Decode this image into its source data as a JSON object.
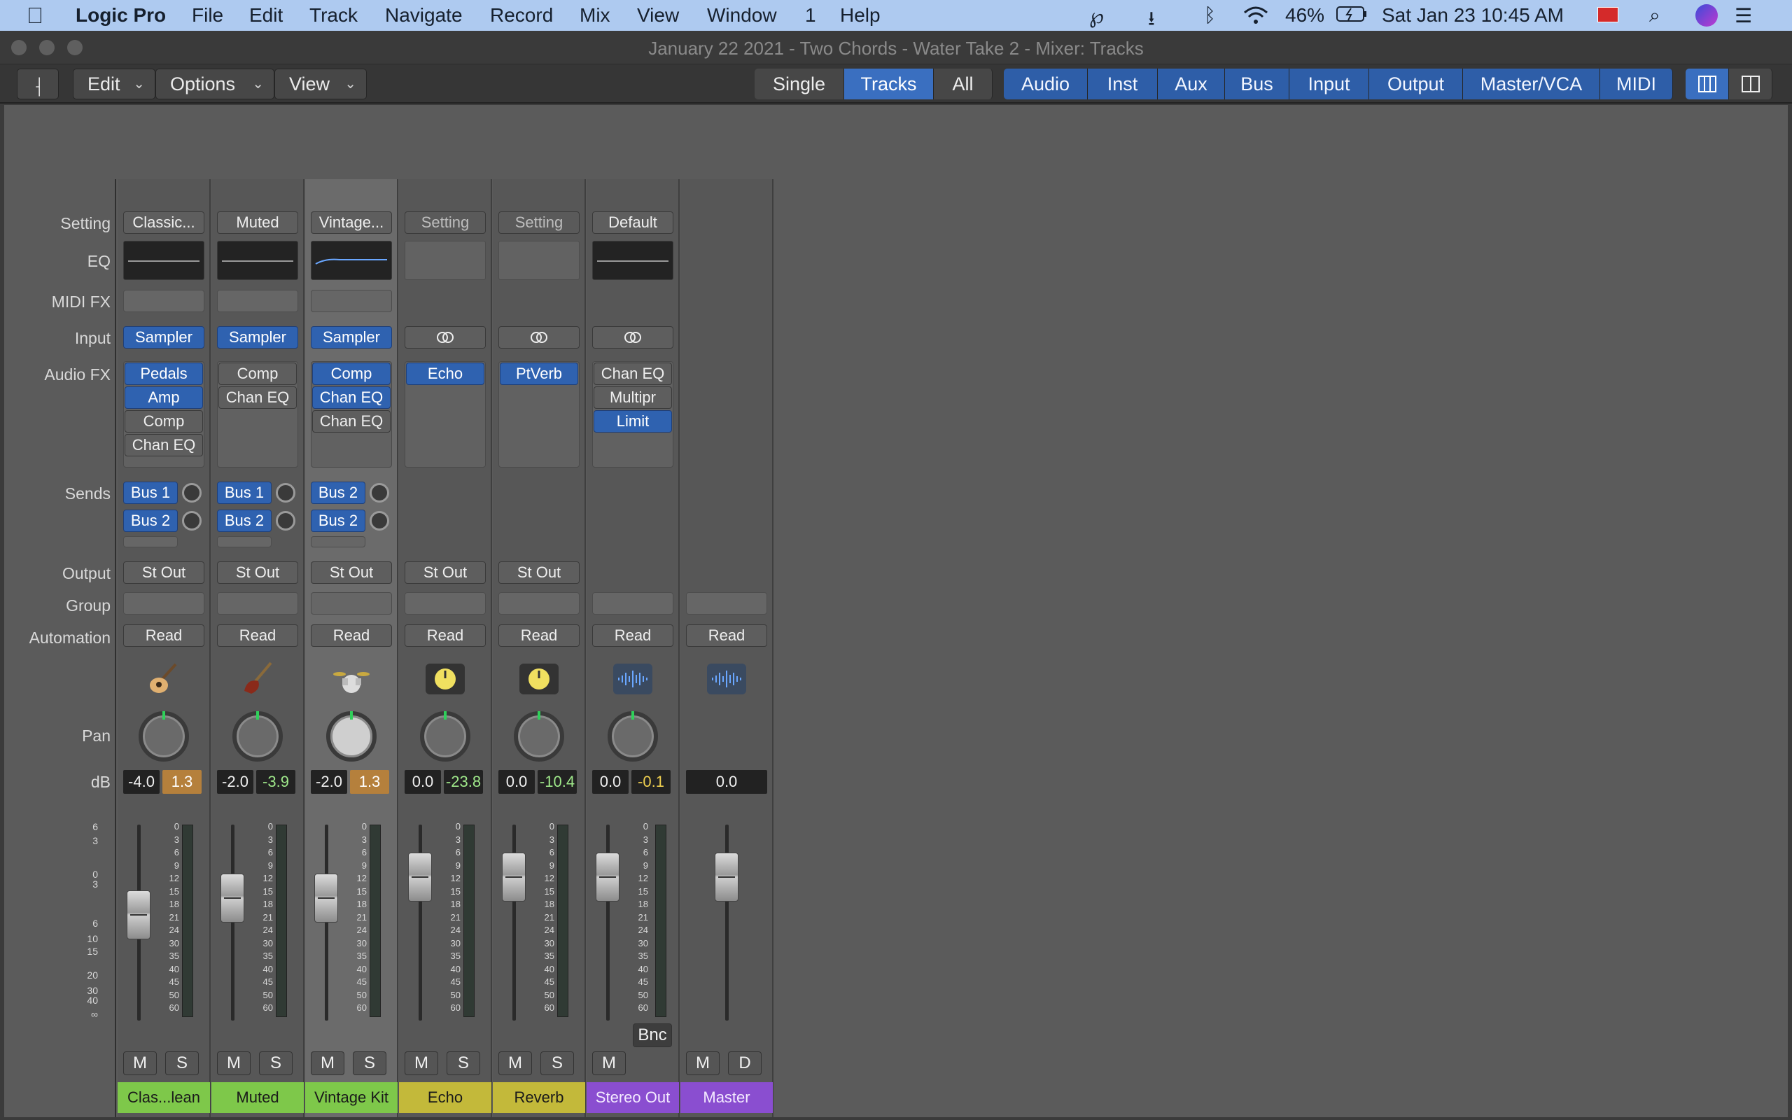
{
  "menubar": {
    "app": "Logic Pro",
    "items": [
      "File",
      "Edit",
      "Track",
      "Navigate",
      "Record",
      "Mix",
      "View",
      "Window",
      "1",
      "Help"
    ],
    "battery": "46%",
    "datetime": "Sat Jan 23  10:45 AM"
  },
  "window": {
    "title": "January 22 2021 - Two Chords - Water Take 2  - Mixer: Tracks"
  },
  "toolbar": {
    "menus": [
      "Edit",
      "Options",
      "View"
    ],
    "view_modes": [
      "Single",
      "Tracks",
      "All"
    ],
    "active_view_mode": "Tracks",
    "filters": [
      "Audio",
      "Inst",
      "Aux",
      "Bus",
      "Input",
      "Output",
      "Master/VCA",
      "MIDI"
    ]
  },
  "row_labels": {
    "setting": "Setting",
    "eq": "EQ",
    "midifx": "MIDI FX",
    "input": "Input",
    "audiofx": "Audio FX",
    "sends": "Sends",
    "output": "Output",
    "group": "Group",
    "automation": "Automation",
    "pan": "Pan",
    "db": "dB"
  },
  "fader_scale_left": [
    "6",
    "3",
    "0",
    "3",
    "6",
    "10",
    "15",
    "20",
    "30",
    "40",
    "∞"
  ],
  "meter_scale": [
    "0",
    "3",
    "6",
    "9",
    "12",
    "15",
    "18",
    "21",
    "24",
    "30",
    "35",
    "40",
    "45",
    "50",
    "60"
  ],
  "strips": [
    {
      "name": "Clas...lean",
      "setting": "Classic...",
      "eq_active": true,
      "input": "Sampler",
      "fx": [
        "Pedals",
        "Amp",
        "Comp",
        "Chan EQ"
      ],
      "fx_active": [
        true,
        true,
        false,
        false
      ],
      "sends": [
        "Bus 1",
        "Bus 2"
      ],
      "output": "St Out",
      "automation": "Read",
      "icon": "acoustic-guitar-icon",
      "db_left": "-4.0",
      "db_right": "1.3",
      "db_right_style": "orange",
      "mute": "M",
      "solo": "S",
      "color": "#7ec84a",
      "fader_db": -4.0
    },
    {
      "name": "Muted",
      "setting": "Muted",
      "eq_active": true,
      "input": "Sampler",
      "fx": [
        "Comp",
        "Chan EQ"
      ],
      "fx_active": [
        false,
        false
      ],
      "sends": [
        "Bus 1",
        "Bus 2"
      ],
      "output": "St Out",
      "automation": "Read",
      "icon": "electric-bass-icon",
      "db_left": "-2.0",
      "db_right": "-3.9",
      "db_right_style": "green",
      "mute": "M",
      "solo": "S",
      "color": "#7ec84a",
      "fader_db": -2.0
    },
    {
      "name": "Vintage Kit",
      "setting": "Vintage...",
      "eq_active": true,
      "input": "Sampler",
      "fx": [
        "Comp",
        "Chan EQ",
        "Chan EQ"
      ],
      "fx_active": [
        true,
        true,
        false
      ],
      "sends": [
        "Bus 2",
        "Bus 2"
      ],
      "output": "St Out",
      "automation": "Read",
      "icon": "drum-kit-icon",
      "db_left": "-2.0",
      "db_right": "1.3",
      "db_right_style": "orange",
      "mute": "M",
      "solo": "S",
      "color": "#7ec84a",
      "fader_db": -2.0
    },
    {
      "name": "Echo",
      "setting": "Setting",
      "eq_active": false,
      "input": "link",
      "fx": [
        "Echo"
      ],
      "fx_active": [
        true
      ],
      "sends": [],
      "output": "St Out",
      "automation": "Read",
      "icon": "aux-knob-icon",
      "db_left": "0.0",
      "db_right": "-23.8",
      "db_right_style": "green",
      "mute": "M",
      "solo": "S",
      "color": "#c3b93a",
      "fader_db": 0.0
    },
    {
      "name": "Reverb",
      "setting": "Setting",
      "eq_active": false,
      "input": "link",
      "fx": [
        "PtVerb"
      ],
      "fx_active": [
        true
      ],
      "sends": [],
      "output": "St Out",
      "automation": "Read",
      "icon": "aux-knob-icon",
      "db_left": "0.0",
      "db_right": "-10.4",
      "db_right_style": "green",
      "mute": "M",
      "solo": "S",
      "color": "#c3b93a",
      "fader_db": 0.0
    },
    {
      "name": "Stereo Out",
      "setting": "Default",
      "eq_active": true,
      "input": "link",
      "fx": [
        "Chan EQ",
        "Multipr",
        "Limit"
      ],
      "fx_active": [
        false,
        false,
        true
      ],
      "sends": [],
      "output": "",
      "automation": "Read",
      "icon": "waveform-icon",
      "db_left": "0.0",
      "db_right": "-0.1",
      "db_right_style": "yellow",
      "mute": "M",
      "solo": "",
      "bnc": "Bnc",
      "color": "#8a4ed0",
      "fader_db": 0.0
    },
    {
      "name": "Master",
      "setting": "",
      "eq_active": false,
      "input": "",
      "fx": [],
      "fx_active": [],
      "sends": [],
      "output": "",
      "automation": "Read",
      "icon": "waveform-icon",
      "db_left": "0.0",
      "db_right": "",
      "db_right_style": "",
      "mute": "M",
      "solo": "D",
      "color": "#8a4ed0",
      "fader_db": 0.0
    }
  ]
}
